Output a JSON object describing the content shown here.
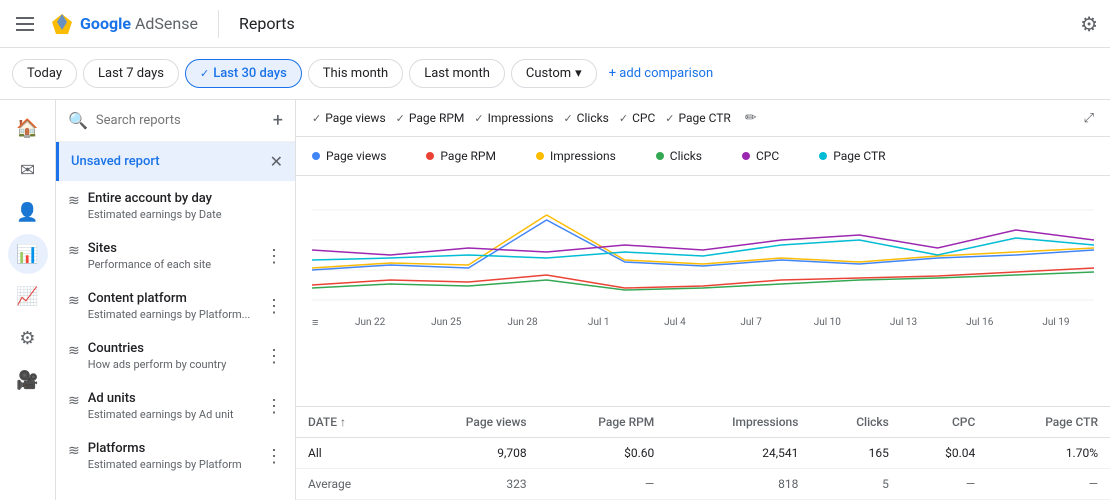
{
  "header": {
    "menu_icon": "☰",
    "logo_text": "Google AdSense",
    "divider": true,
    "title": "Reports",
    "settings_icon": "⚙"
  },
  "filter_bar": {
    "buttons": [
      {
        "label": "Today",
        "active": false
      },
      {
        "label": "Last 7 days",
        "active": false
      },
      {
        "label": "Last 30 days",
        "active": true
      },
      {
        "label": "This month",
        "active": false
      },
      {
        "label": "Last month",
        "active": false
      },
      {
        "label": "Custom",
        "active": false,
        "has_arrow": true
      }
    ],
    "add_comparison": "+ add comparison"
  },
  "sidebar_icons": [
    "🏠",
    "📧",
    "👤",
    "📊",
    "📈",
    "⚙",
    "🎥"
  ],
  "sidebar": {
    "search_placeholder": "Search reports",
    "add_label": "+",
    "unsaved_report": "Unsaved report",
    "nav_items": [
      {
        "title": "Entire account by day",
        "sub": "Estimated earnings by Date"
      },
      {
        "title": "Sites",
        "sub": "Performance of each site"
      },
      {
        "title": "Content platform",
        "sub": "Estimated earnings by Platform..."
      },
      {
        "title": "Countries",
        "sub": "How ads perform by country"
      },
      {
        "title": "Ad units",
        "sub": "Estimated earnings by Ad unit"
      },
      {
        "title": "Platforms",
        "sub": "Estimated earnings by Platform"
      }
    ]
  },
  "chips": [
    {
      "label": "Page views",
      "color": "#4285f4"
    },
    {
      "label": "Page RPM",
      "color": "#ea4335"
    },
    {
      "label": "Impressions",
      "color": "#fbbc04"
    },
    {
      "label": "Clicks",
      "color": "#34a853"
    },
    {
      "label": "CPC",
      "color": "#9c27b0"
    },
    {
      "label": "Page CTR",
      "color": "#00bcd4"
    }
  ],
  "legend": [
    {
      "label": "Page views",
      "color": "#4285f4"
    },
    {
      "label": "Page RPM",
      "color": "#ea4335"
    },
    {
      "label": "Impressions",
      "color": "#fbbc04"
    },
    {
      "label": "Clicks",
      "color": "#34a853"
    },
    {
      "label": "CPC",
      "color": "#9c27b0"
    },
    {
      "label": "Page CTR",
      "color": "#00bcd4"
    }
  ],
  "axis_labels": [
    "Jun 22",
    "Jun 25",
    "Jun 28",
    "Jul 1",
    "Jul 4",
    "Jul 7",
    "Jul 10",
    "Jul 13",
    "Jul 16",
    "Jul 19"
  ],
  "table": {
    "columns": [
      "DATE ↑",
      "Page views",
      "Page RPM",
      "Impressions",
      "Clicks",
      "CPC",
      "Page CTR"
    ],
    "rows": [
      {
        "label": "All",
        "page_views": "9,708",
        "page_rpm": "$0.60",
        "impressions": "24,541",
        "clicks": "165",
        "cpc": "$0.04",
        "page_ctr": "1.70%"
      },
      {
        "label": "Average",
        "page_views": "323",
        "page_rpm": "—",
        "impressions": "818",
        "clicks": "5",
        "cpc": "—",
        "page_ctr": "—"
      }
    ]
  }
}
